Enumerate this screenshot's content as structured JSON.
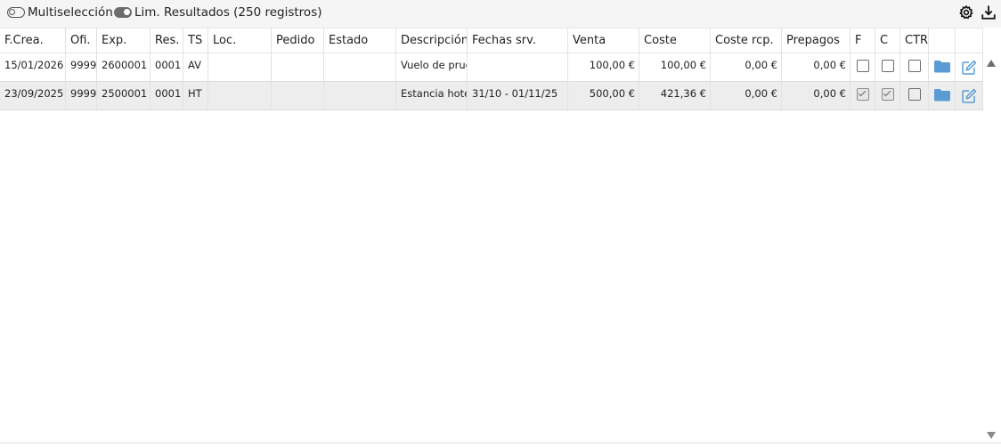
{
  "toolbar": {
    "multiselect_label": "Multiselección",
    "limit_label": "Lim. Resultados (250 registros)",
    "multiselect_state": "off",
    "limit_state": "on",
    "settings_icon": "gear-icon",
    "download_icon": "download-icon"
  },
  "table": {
    "columns": [
      "F.Crea.",
      "Ofi.",
      "Exp.",
      "Res.",
      "TS",
      "Loc.",
      "Pedido",
      "Estado",
      "Descripción",
      "Fechas srv.",
      "Venta",
      "Coste",
      "Coste rcp.",
      "Prepagos",
      "F",
      "C",
      "CTR",
      "",
      ""
    ],
    "rows": [
      {
        "fcrea": "15/01/2026",
        "ofi": "9999",
        "exp": "2600001",
        "res": "0001",
        "ts": "AV",
        "loc": "",
        "pedido": "",
        "estado": "",
        "descripcion": "Vuelo de prue",
        "fechas": "",
        "venta": "100,00 €",
        "coste": "100,00 €",
        "coste_rcp": "0,00 €",
        "prepagos": "0,00 €",
        "f": false,
        "c": false,
        "ctr": false
      },
      {
        "fcrea": "23/09/2025",
        "ofi": "9999",
        "exp": "2500001",
        "res": "0001",
        "ts": "HT",
        "loc": "",
        "pedido": "",
        "estado": "",
        "descripcion": "Estancia hotel",
        "fechas": "31/10 - 01/11/25",
        "venta": "500,00 €",
        "coste": "421,36 €",
        "coste_rcp": "0,00 €",
        "prepagos": "0,00 €",
        "f": true,
        "c": true,
        "ctr": false
      }
    ]
  },
  "icons": {
    "row_folder": "folder-icon",
    "row_edit": "edit-icon",
    "scroll_up": "triangle-up-icon",
    "scroll_down": "triangle-down-icon"
  },
  "colors": {
    "folder_blue": "#5b9bd5",
    "selected_row": "#ededed",
    "toolbar_bg": "#f5f5f5"
  }
}
